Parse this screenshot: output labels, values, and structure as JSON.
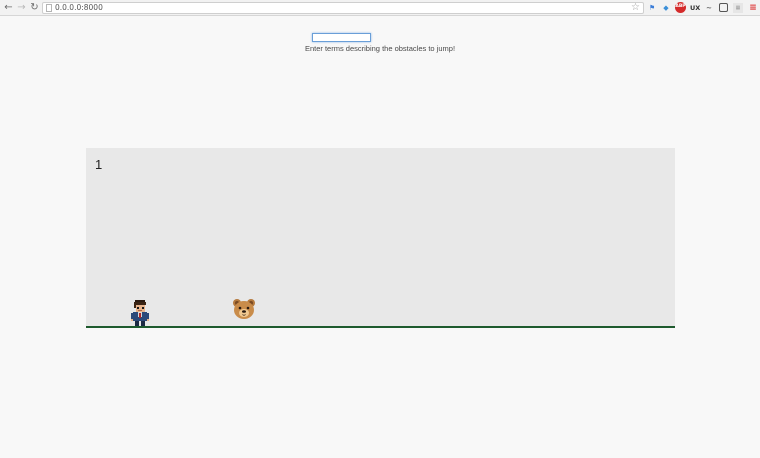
{
  "browser": {
    "url": "0.0.0.0:8000"
  },
  "form": {
    "input_value": "",
    "instruction": "Enter terms describing the obstacles to jump!"
  },
  "game": {
    "score": "1",
    "player": "pixel-character",
    "obstacle": "bear-emoji"
  },
  "colors": {
    "page_background": "#f8f8f8",
    "game_background": "#e8e8e8",
    "ground": "#1e5a2e",
    "input_focus_border": "#6a9fd8"
  }
}
